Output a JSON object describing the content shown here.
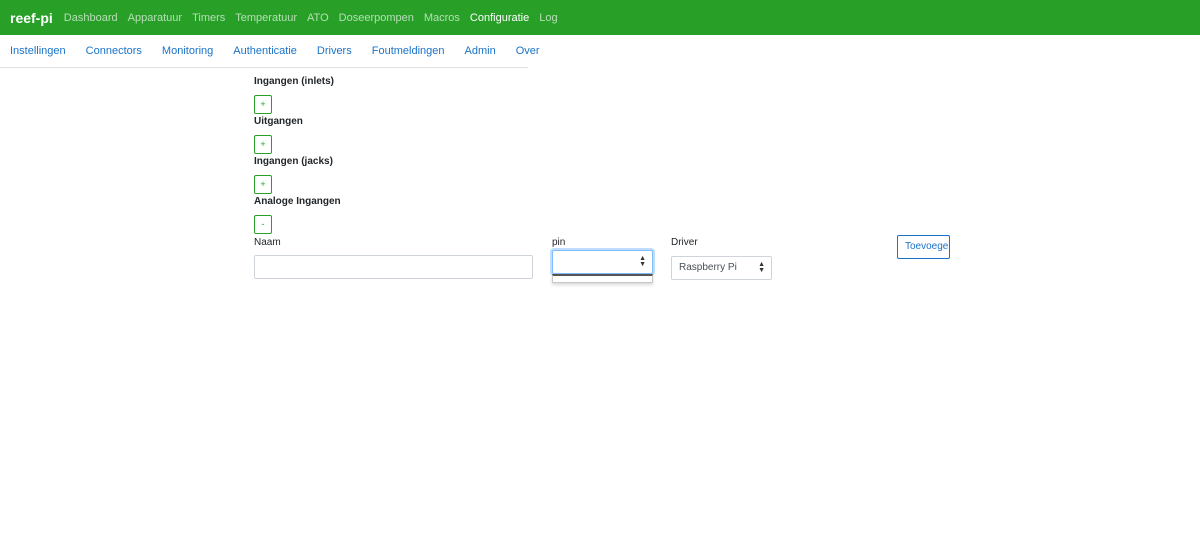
{
  "navbar": {
    "brand": "reef-pi",
    "items": [
      "Dashboard",
      "Apparatuur",
      "Timers",
      "Temperatuur",
      "ATO",
      "Doseerpompen",
      "Macros",
      "Configuratie",
      "Log"
    ],
    "active": "Configuratie"
  },
  "subnav": {
    "items": [
      "Instellingen",
      "Connectors",
      "Monitoring",
      "Authenticatie",
      "Drivers",
      "Foutmeldingen",
      "Admin",
      "Over"
    ]
  },
  "sections": {
    "inlets": {
      "title": "Ingangen (inlets)",
      "toggle": "+"
    },
    "outlets": {
      "title": "Uitgangen",
      "toggle": "+"
    },
    "jacks": {
      "title": "Ingangen (jacks)",
      "toggle": "+"
    },
    "analog": {
      "title": "Analoge Ingangen",
      "toggle": "-"
    }
  },
  "form": {
    "name_label": "Naam",
    "name_value": "",
    "pin_label": "pin",
    "pin_value": "",
    "driver_label": "Driver",
    "driver_value": "Raspberry Pi",
    "add_label": "Toevoegen"
  },
  "colors": {
    "navbar": "#28a028",
    "link": "#1a73c8",
    "success": "#28a028"
  }
}
